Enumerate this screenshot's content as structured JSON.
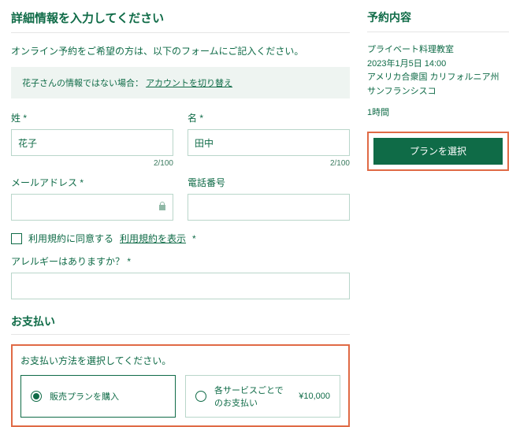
{
  "main": {
    "title": "詳細情報を入力してください",
    "intro": "オンライン予約をご希望の方は、以下のフォームにご記入ください。",
    "notice_prefix": "花子さんの情報ではない場合：",
    "notice_link": "アカウントを切り替え",
    "labels": {
      "lastname": "姓",
      "firstname": "名",
      "email": "メールアドレス",
      "phone": "電話番号",
      "allergy": "アレルギーはありますか？"
    },
    "values": {
      "lastname": "花子",
      "firstname": "田中",
      "email": "",
      "phone": ""
    },
    "counters": {
      "lastname": "2/100",
      "firstname": "2/100"
    },
    "terms_label": "利用規約に同意する",
    "terms_link": "利用規約を表示",
    "payment_heading": "お支払い",
    "payment_title": "お支払い方法を選択してください。",
    "pay_opt1": "販売プランを購入",
    "pay_opt2": "各サービスごとでのお支払い",
    "pay_opt2_price": "¥10,000"
  },
  "side": {
    "heading": "予約内容",
    "event": "プライベート料理教室",
    "datetime": "2023年1月5日 14:00",
    "location": "アメリカ合衆国 カリフォルニア州 サンフランシスコ",
    "duration": "1時間",
    "cta": "プランを選択"
  }
}
